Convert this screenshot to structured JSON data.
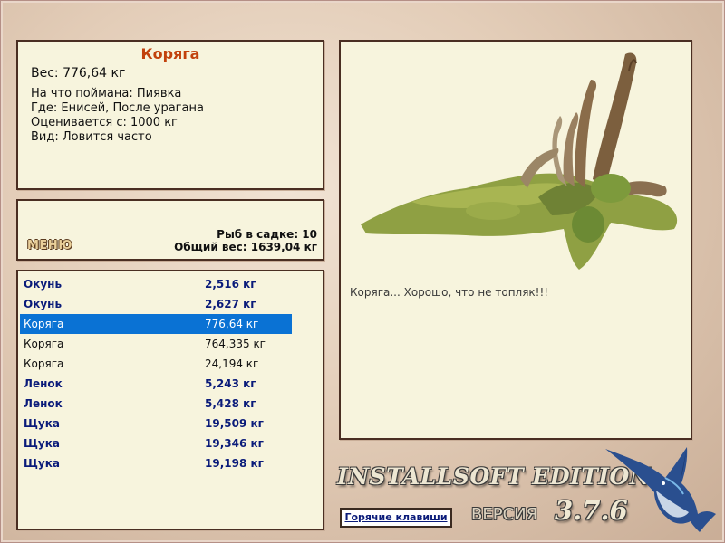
{
  "catch_info": {
    "title": "Коряга",
    "weight": "Вес: 776,64 кг",
    "caught_with": "На что поймана: Пиявка",
    "location": "Где: Енисей, После урагана",
    "valued_from": "Оценивается с: 1000 кг",
    "kind": "Вид: Ловится часто"
  },
  "menu": {
    "label": "МЕНЮ"
  },
  "summary": {
    "fish_in_keepnet": "Рыб в садке: 10",
    "total_weight": "Общий вес: 1639,04 кг"
  },
  "catch_list": [
    {
      "name": "Окунь",
      "weight": "2,516 кг",
      "style": "trophy"
    },
    {
      "name": "Окунь",
      "weight": "2,627 кг",
      "style": "trophy"
    },
    {
      "name": "Коряга",
      "weight": "776,64 кг",
      "style": "selected"
    },
    {
      "name": "Коряга",
      "weight": "764,335 кг",
      "style": "plain"
    },
    {
      "name": "Коряга",
      "weight": "24,194 кг",
      "style": "plain"
    },
    {
      "name": "Ленок",
      "weight": "5,243 кг",
      "style": "trophy"
    },
    {
      "name": "Ленок",
      "weight": "5,428 кг",
      "style": "trophy"
    },
    {
      "name": "Щука",
      "weight": "19,509 кг",
      "style": "trophy"
    },
    {
      "name": "Щука",
      "weight": "19,346 кг",
      "style": "trophy"
    },
    {
      "name": "Щука",
      "weight": "19,198 кг",
      "style": "trophy"
    }
  ],
  "preview": {
    "image": "driftwood-snag-image",
    "caption": "Коряга... Хорошо, что не топляк!!!"
  },
  "footer": {
    "brand": "INSTALLSOFT EDITION",
    "version_label": "ВЕРСИЯ",
    "version_number": "3.7.6",
    "hotkeys_label": "Горячие клавиши",
    "logo": "marlin-icon"
  },
  "colors": {
    "panel_bg": "#f7f4dd",
    "panel_border": "#4a2e22",
    "title": "#c2410c",
    "trophy_text": "#0a1b7a",
    "selection": "#0a72d4"
  }
}
